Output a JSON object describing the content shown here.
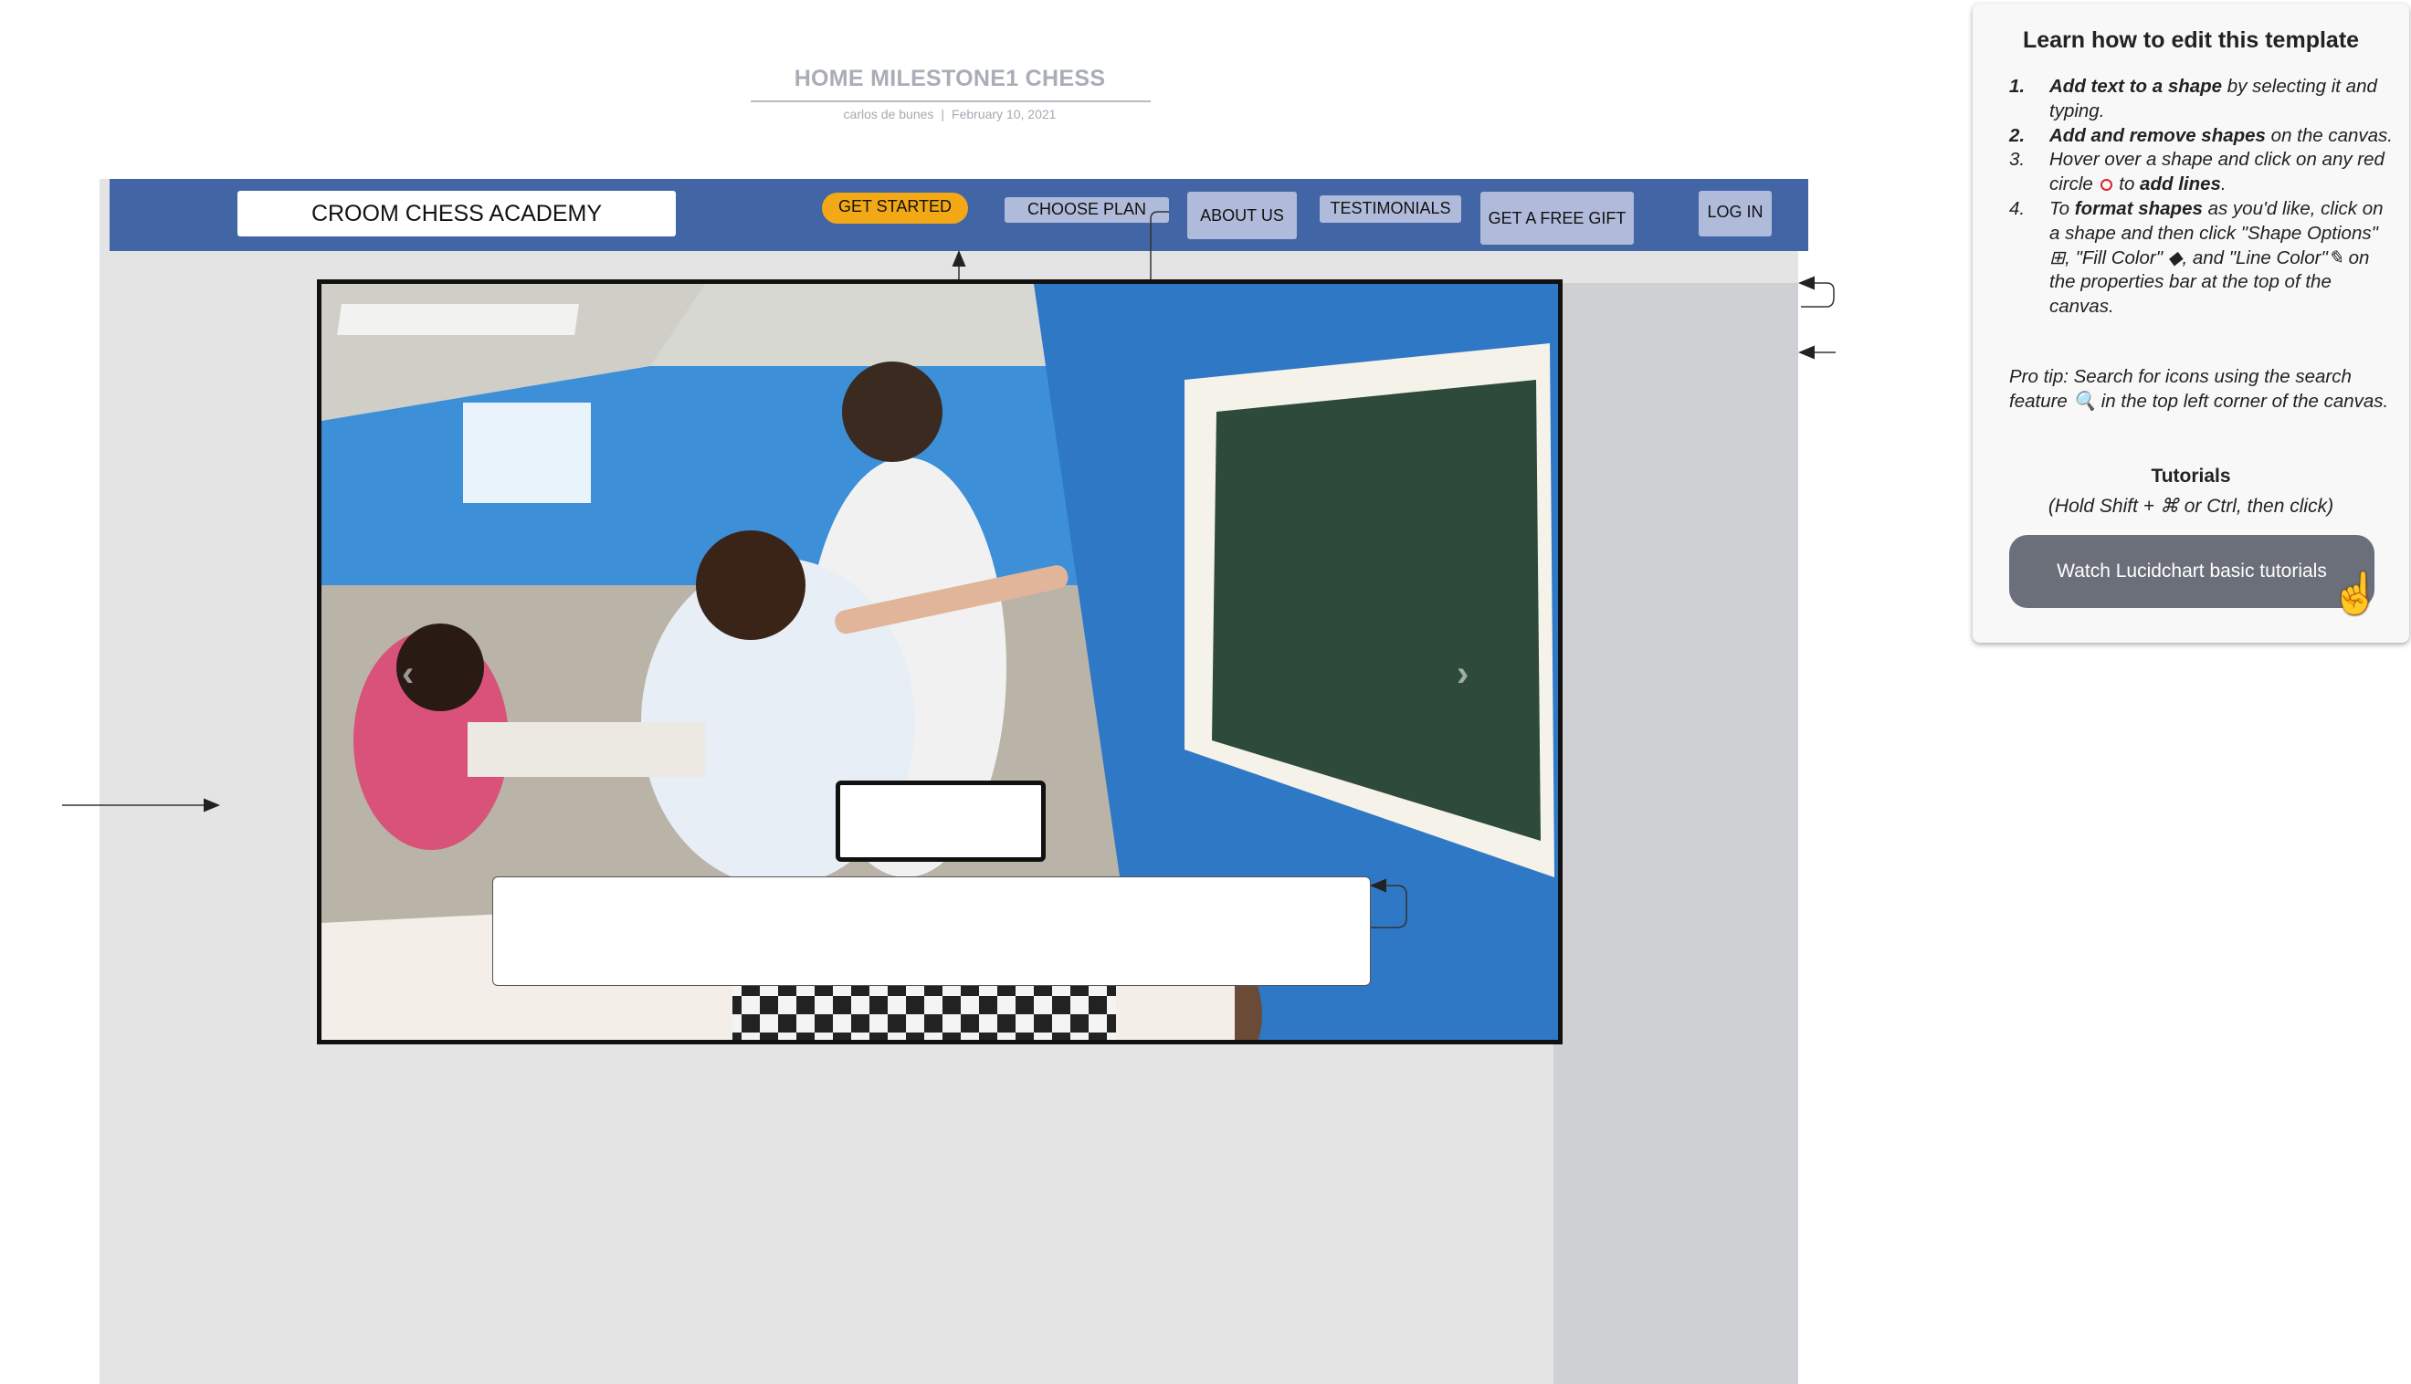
{
  "document": {
    "title": "HOME MILESTONE1 CHESS",
    "author": "carlos de bunes",
    "date": "February 10, 2021"
  },
  "nav": {
    "brand": "CROOM CHESS ACADEMY",
    "get_started": "GET STARTED",
    "choose_plan": "CHOOSE PLAN",
    "about_us": "ABOUT US",
    "testimonials": "TESTIMONIALS",
    "free_gift": "GET A FREE GIFT",
    "log_in": "LOG IN"
  },
  "hero": {
    "image_label": "Chess class photo",
    "prev_icon": "chevron-left-icon",
    "next_icon": "chevron-right-icon"
  },
  "help": {
    "title": "Learn how to edit this template",
    "items": [
      {
        "num": "1.",
        "bold": "Add text to a shape",
        "rest": " by selecting it and typing."
      },
      {
        "num": "2.",
        "bold": "Add and remove shapes",
        "rest": " on the canvas."
      },
      {
        "num": "3.",
        "pre": "Hover over a shape and click on any red circle ",
        "mid": " to ",
        "bold": "add lines",
        "rest": "."
      },
      {
        "num": "4.",
        "pre": "To ",
        "bold": "format shapes",
        "rest": " as you'd like, click on a shape and then click \"Shape Options\" ⊞, \"Fill Color\" ◆, and \"Line Color\"✎ on the properties bar at the top of the canvas."
      }
    ],
    "pro_tip": "Pro tip: Search for icons using the search feature 🔍 in the top left corner of the canvas.",
    "tutorials_title": "Tutorials",
    "tutorials_hint": "(Hold Shift + ⌘ or Ctrl, then click)",
    "tutorials_button": "Watch Lucidchart basic tutorials"
  },
  "colors": {
    "navbar": "#4265a6",
    "nav_button": "#b0bada",
    "get_started": "#f3a916",
    "canvas": "#e4e4e4",
    "tutorial_button": "#6b6f79"
  }
}
